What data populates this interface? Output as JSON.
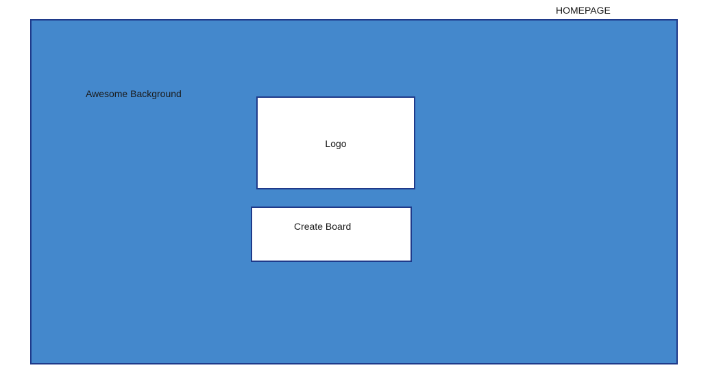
{
  "page": {
    "title": "HOMEPAGE"
  },
  "background": {
    "label": "Awesome Background",
    "color": "#4488cc",
    "border_color": "#1f3a8a"
  },
  "logo": {
    "label": "Logo"
  },
  "create_board": {
    "label": "Create Board"
  }
}
